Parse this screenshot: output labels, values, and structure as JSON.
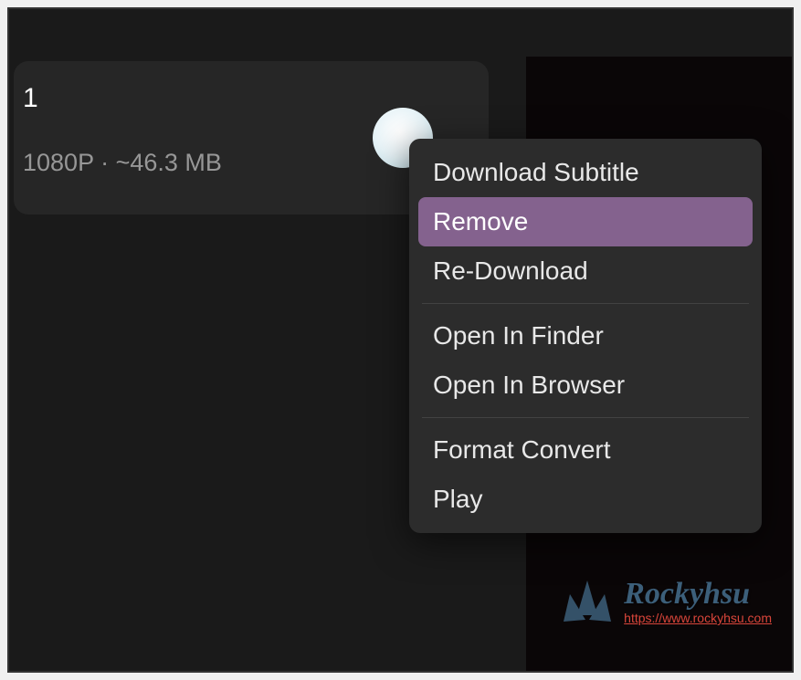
{
  "download_item": {
    "title": "1",
    "resolution": "1080P",
    "separator": " · ",
    "size": "~46.3 MB"
  },
  "context_menu": {
    "items": [
      {
        "label": "Download Subtitle",
        "selected": false
      },
      {
        "label": "Remove",
        "selected": true
      },
      {
        "label": "Re-Download",
        "selected": false
      }
    ],
    "items2": [
      {
        "label": "Open In Finder",
        "selected": false
      },
      {
        "label": "Open In Browser",
        "selected": false
      }
    ],
    "items3": [
      {
        "label": "Format Convert",
        "selected": false
      },
      {
        "label": "Play",
        "selected": false
      }
    ]
  },
  "watermark": {
    "title": "Rockyhsu",
    "url": "https://www.rockyhsu.com"
  }
}
